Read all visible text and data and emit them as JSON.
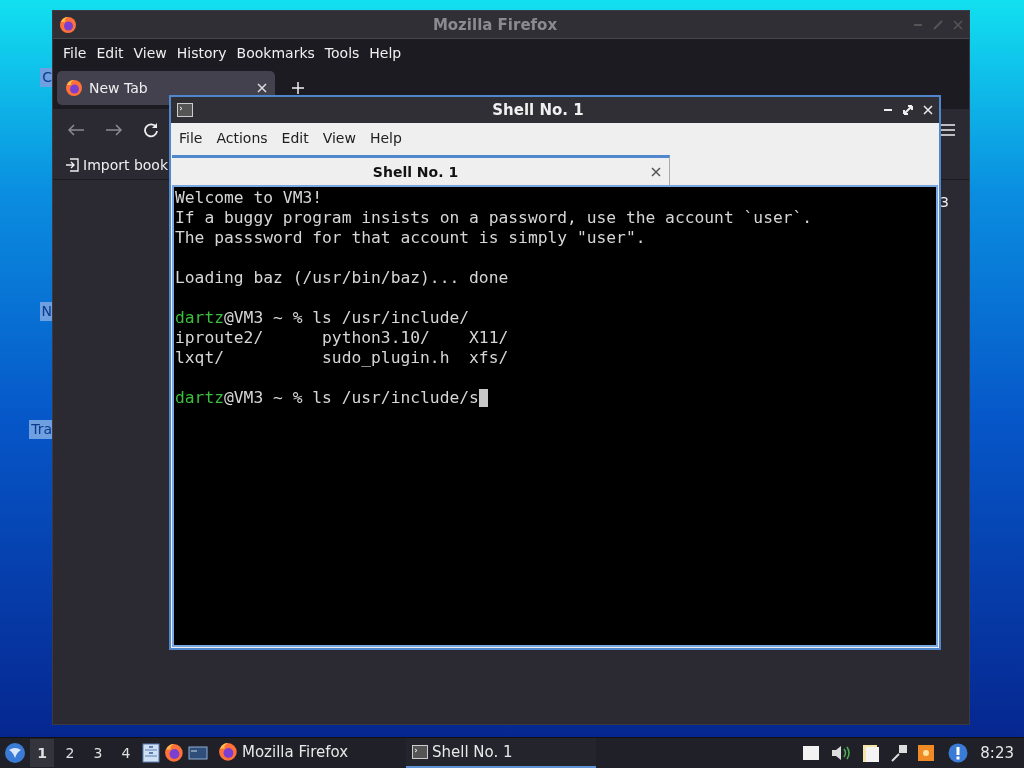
{
  "desktop": {
    "icon_labels": [
      "C",
      "N",
      "Tra"
    ]
  },
  "firefox": {
    "title": "Mozilla Firefox",
    "active": false,
    "menu": [
      "File",
      "Edit",
      "View",
      "History",
      "Bookmarks",
      "Tools",
      "Help"
    ],
    "tabs": [
      {
        "label": "New Tab",
        "selected": true
      }
    ],
    "bookmarks": [
      "Import book"
    ],
    "content_text": "3"
  },
  "shell": {
    "title": "Shell No. 1",
    "active": true,
    "menu": [
      "File",
      "Actions",
      "Edit",
      "View",
      "Help"
    ],
    "tabs": [
      {
        "label": "Shell No. 1",
        "selected": true
      }
    ],
    "lines": [
      {
        "kind": "text",
        "text": "Welcome to VM3!"
      },
      {
        "kind": "text",
        "text": "If a buggy program insists on a password, use the account `user`."
      },
      {
        "kind": "text",
        "text": "The passsword for that account is simply \"user\"."
      },
      {
        "kind": "blank"
      },
      {
        "kind": "text",
        "text": "Loading baz (/usr/bin/baz)... done"
      },
      {
        "kind": "blank"
      },
      {
        "kind": "prompt",
        "user": "dartz",
        "text": "@VM3 ~ % ls /usr/include/"
      },
      {
        "kind": "text",
        "text": "iproute2/      python3.10/    X11/"
      },
      {
        "kind": "text",
        "text": "lxqt/          sudo_plugin.h  xfs/"
      },
      {
        "kind": "blank"
      },
      {
        "kind": "prompt",
        "user": "dartz",
        "text": "@VM3 ~ % ls /usr/include/s"
      }
    ],
    "cursor": true
  },
  "taskbar": {
    "workspaces": [
      {
        "label": "1",
        "selected": true
      },
      {
        "label": "2",
        "selected": false
      },
      {
        "label": "3",
        "selected": false
      },
      {
        "label": "4",
        "selected": false
      }
    ],
    "tasks": [
      {
        "label": "Mozilla Firefox",
        "kind": "firefox",
        "selected": false
      },
      {
        "label": "Shell No. 1",
        "kind": "terminal",
        "selected": true
      }
    ],
    "clock": "8:23"
  }
}
